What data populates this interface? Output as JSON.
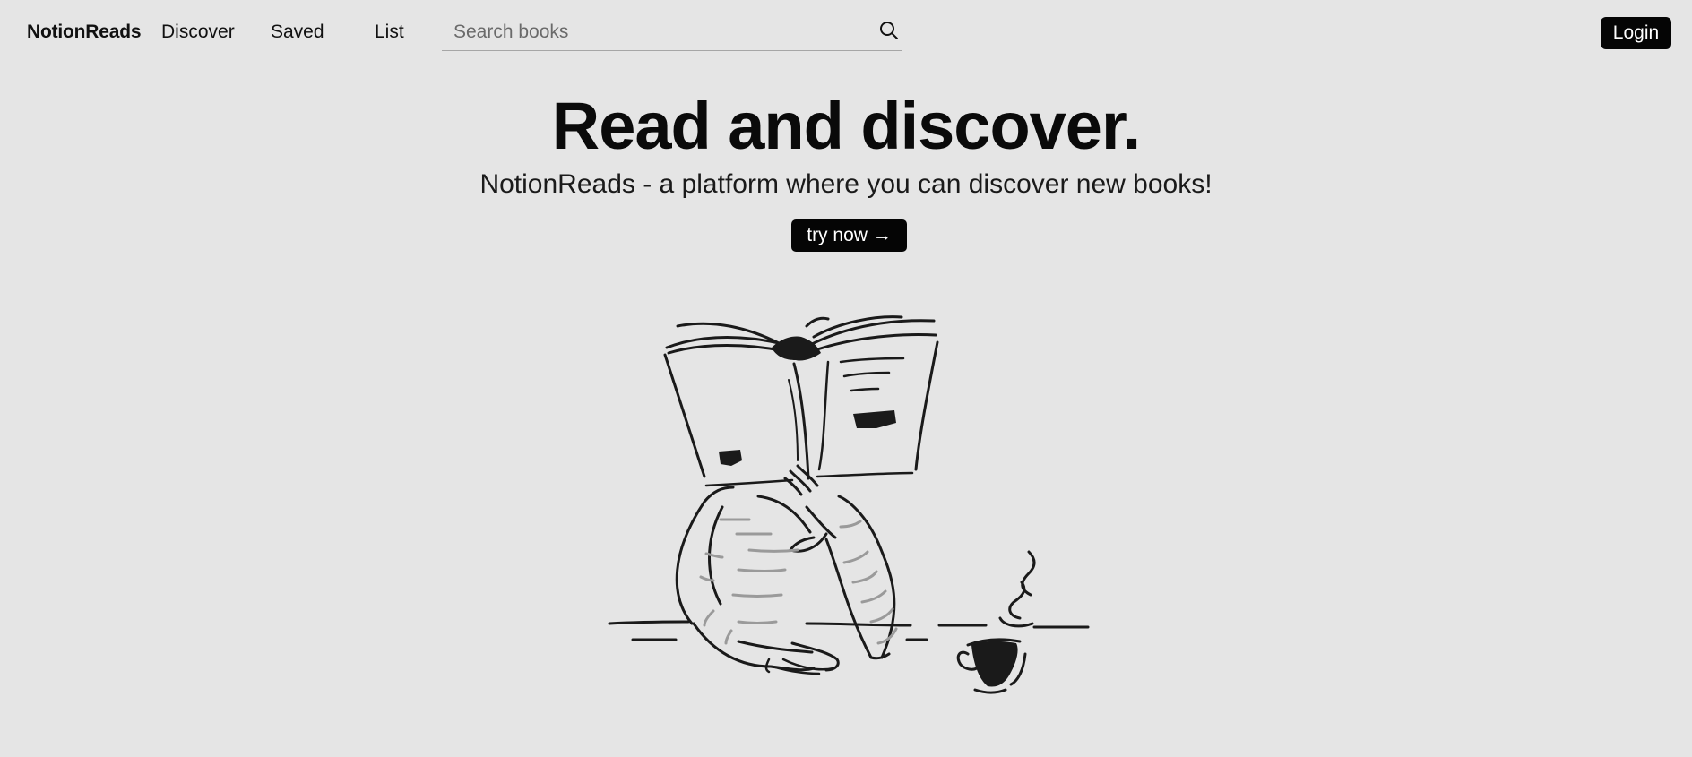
{
  "navbar": {
    "brand": "NotionReads",
    "links": [
      {
        "label": "Discover"
      },
      {
        "label": "Saved"
      },
      {
        "label": "List"
      }
    ],
    "search": {
      "placeholder": "Search books",
      "value": "",
      "icon": "search-icon"
    },
    "login_label": "Login"
  },
  "hero": {
    "title": "Read and discover.",
    "subtitle": "NotionReads - a platform where you can discover new books!",
    "cta_label": "try now →"
  },
  "illustration": {
    "subject": "person-reading-book-with-coffee-cup"
  },
  "colors": {
    "background": "#e5e5e5",
    "button": "#050505",
    "button_text": "#ffffff",
    "text": "#111111"
  }
}
